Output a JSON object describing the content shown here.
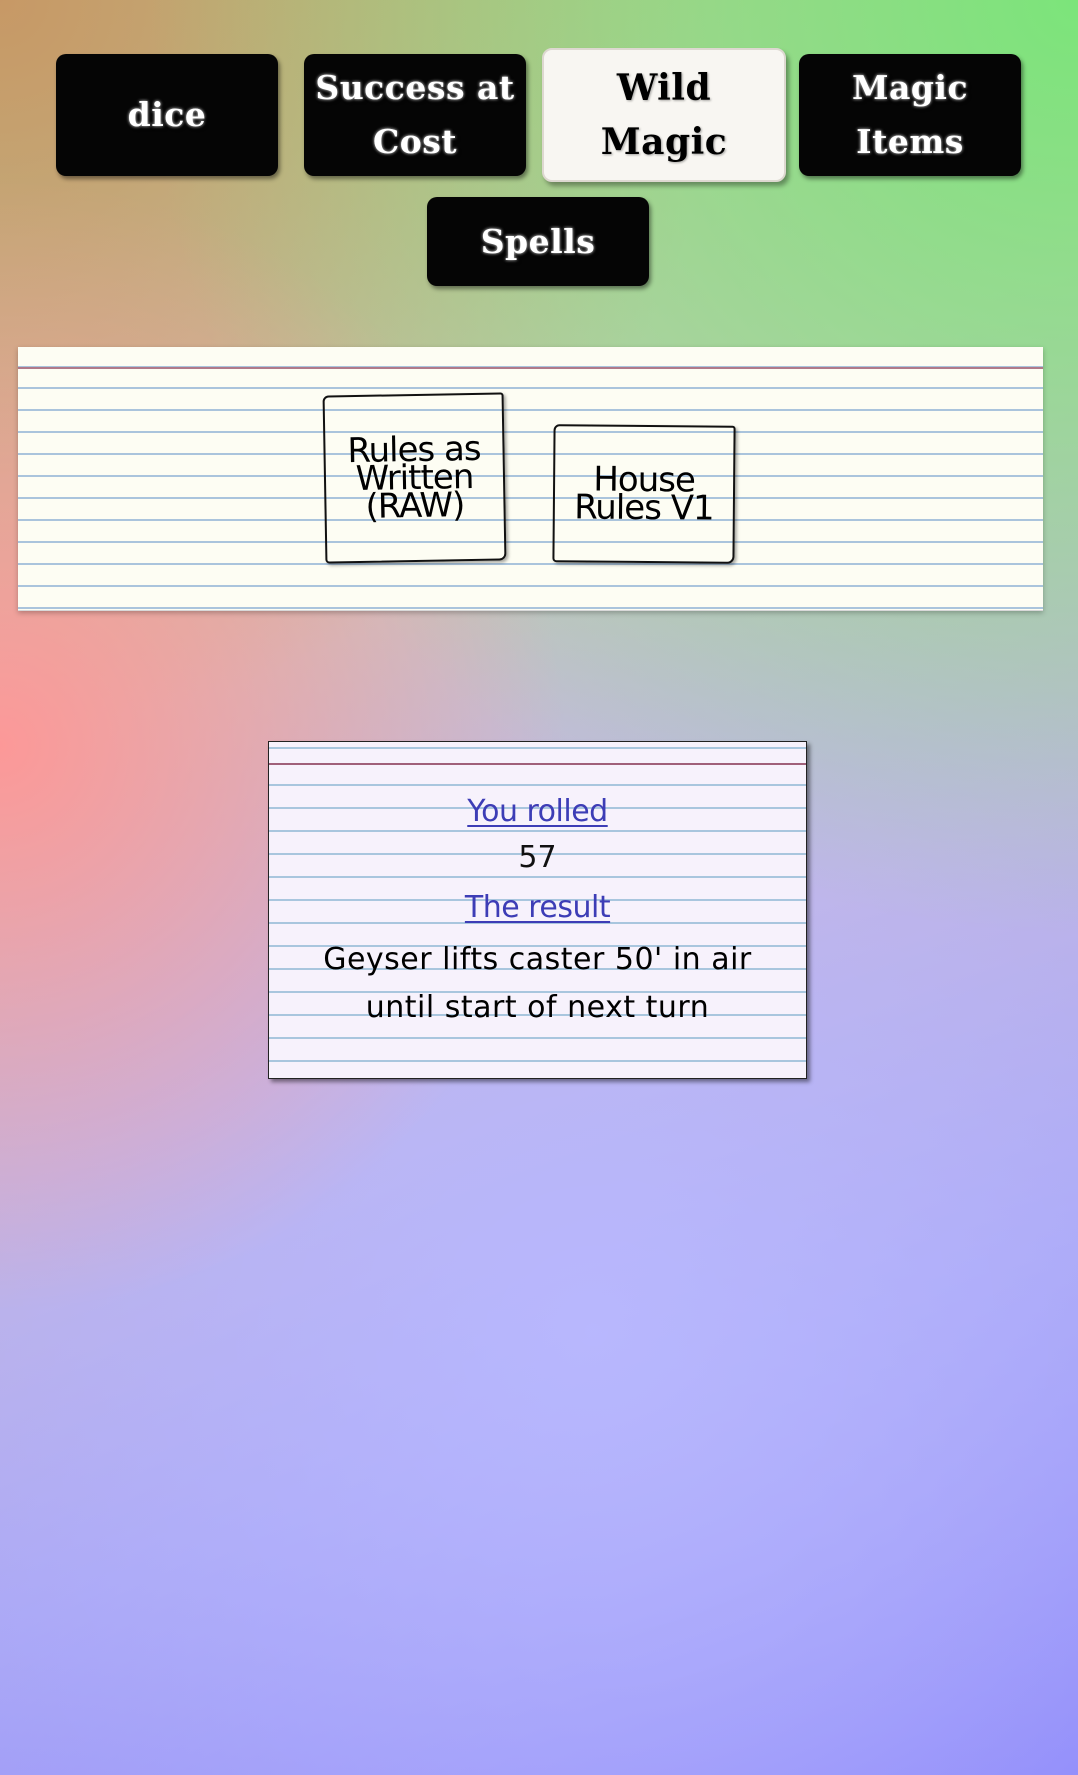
{
  "nav": {
    "dice_label": "dice",
    "success_label": "Success at Cost",
    "wild_label": "Wild Magic",
    "magic_items_label": "Magic Items",
    "spells_label": "Spells",
    "active": "Wild Magic"
  },
  "rules_modes": {
    "raw_label": "Rules as Written (RAW)",
    "house_label": "House Rules V1"
  },
  "result": {
    "rolled_label": "You rolled",
    "roll_value": "57",
    "result_label": "The result",
    "result_text": "Geyser lifts caster 50' in air until start of next turn"
  },
  "colors": {
    "button_bg": "#050505",
    "active_button_bg": "#f8f6f2",
    "label_link": "#3d3db6",
    "card_bg": "#fdfdf3"
  }
}
